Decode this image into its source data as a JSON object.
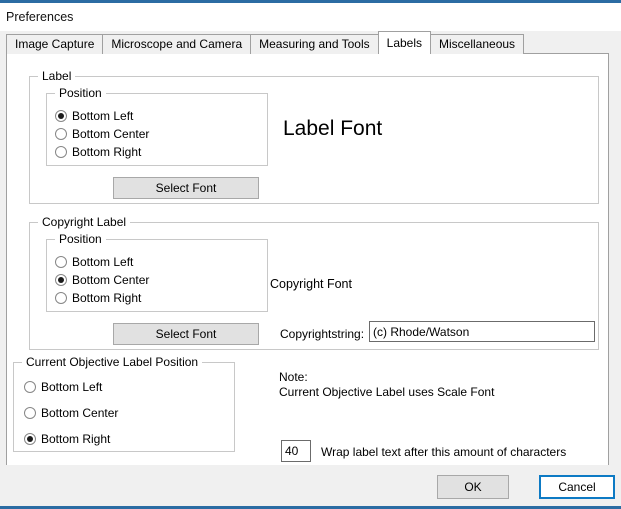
{
  "window": {
    "title": "Preferences",
    "accent_color": "#2b6ca3"
  },
  "tabs": [
    {
      "label": "Image Capture",
      "selected": false
    },
    {
      "label": "Microscope and Camera",
      "selected": false
    },
    {
      "label": "Measuring and Tools",
      "selected": false
    },
    {
      "label": "Labels",
      "selected": true
    },
    {
      "label": "Miscellaneous",
      "selected": false
    }
  ],
  "label_group": {
    "legend": "Label",
    "position_legend": "Position",
    "options": [
      {
        "label": "Bottom Left",
        "checked": true
      },
      {
        "label": "Bottom Center",
        "checked": false
      },
      {
        "label": "Bottom Right",
        "checked": false
      }
    ],
    "select_font_button": "Select Font",
    "font_preview": "Label Font"
  },
  "copyright_group": {
    "legend": "Copyright Label",
    "position_legend": "Position",
    "options": [
      {
        "label": "Bottom Left",
        "checked": false
      },
      {
        "label": "Bottom Center",
        "checked": true
      },
      {
        "label": "Bottom Right",
        "checked": false
      }
    ],
    "select_font_button": "Select Font",
    "font_preview": "Copyright  Font",
    "string_field_label": "Copyrightstring:",
    "string_field_value": "(c) Rhode/Watson"
  },
  "objective_group": {
    "legend": "Current Objective Label Position",
    "options": [
      {
        "label": "Bottom Left",
        "checked": false
      },
      {
        "label": "Bottom Center",
        "checked": false
      },
      {
        "label": "Bottom Right",
        "checked": true
      }
    ]
  },
  "note": {
    "line1": "Note:",
    "line2": "Current Objective Label uses Scale Font"
  },
  "wrap": {
    "value": "40",
    "label": "Wrap label text after this amount of characters"
  },
  "footer": {
    "ok_label": "OK",
    "cancel_label": "Cancel",
    "focus_color": "#0d7ac4"
  }
}
